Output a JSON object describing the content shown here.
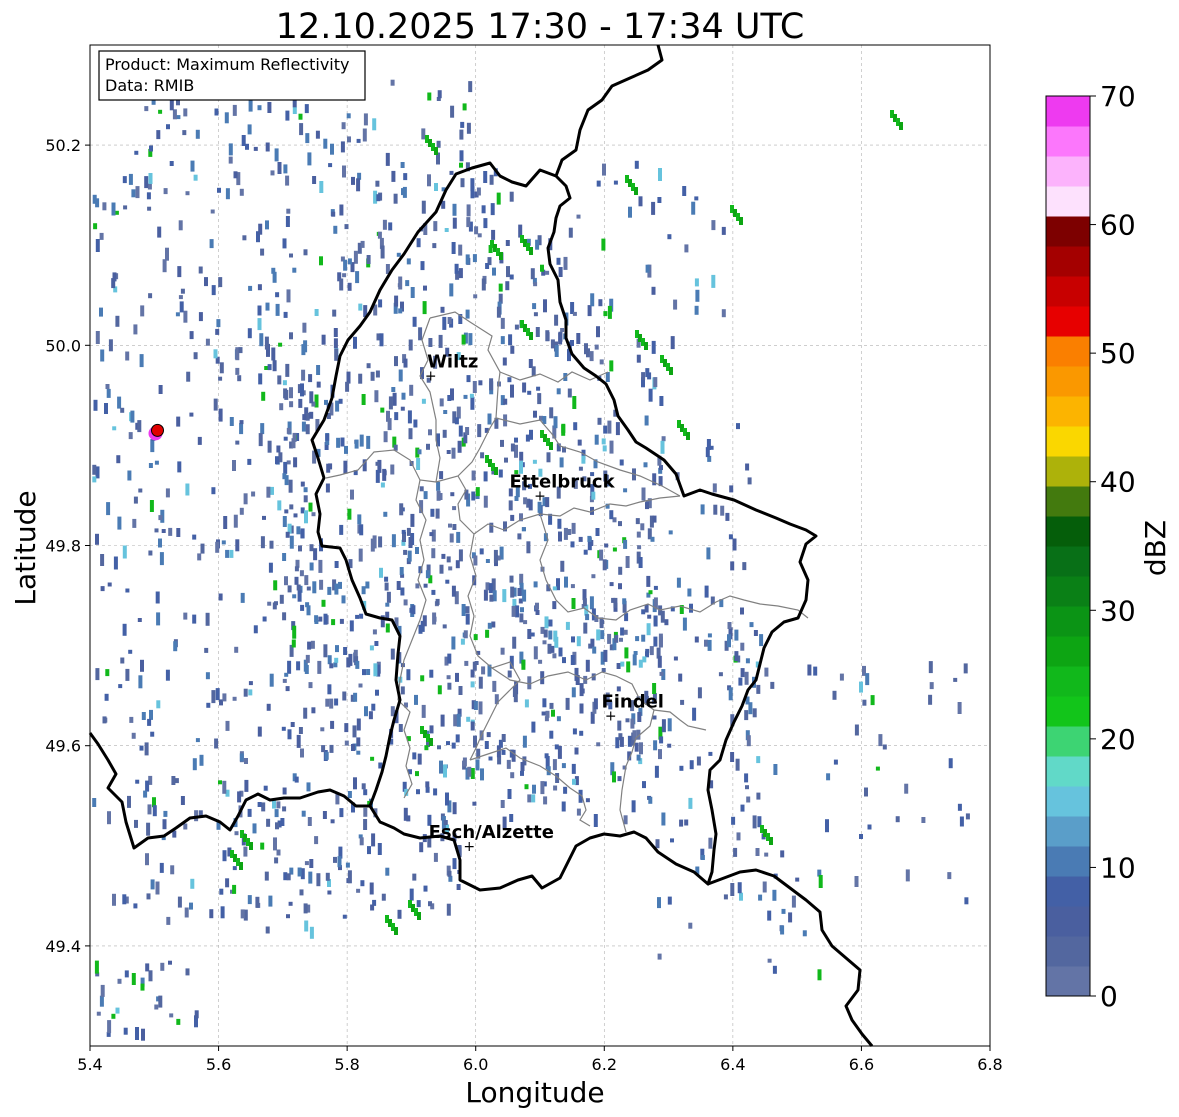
{
  "title": "12.10.2025 17:30 - 17:34 UTC",
  "info_box": {
    "product": "Product: Maximum Reflectivity",
    "data": "Data: RMIB"
  },
  "axes": {
    "xlabel": "Longitude",
    "ylabel": "Latitude",
    "xlim": [
      5.4,
      6.8
    ],
    "ylim": [
      49.3,
      50.3
    ],
    "xticks": [
      "5.4",
      "5.6",
      "5.8",
      "6.0",
      "6.2",
      "6.4",
      "6.6",
      "6.8"
    ],
    "yticks": [
      "49.4",
      "49.6",
      "49.8",
      "50.0",
      "50.2"
    ],
    "grid": true
  },
  "colorbar": {
    "label": "dBZ",
    "ticks": [
      "0",
      "10",
      "20",
      "30",
      "40",
      "50",
      "60",
      "70"
    ],
    "range": [
      0,
      70
    ],
    "colors": [
      "#6374a6",
      "#53679f",
      "#4a5f9f",
      "#4360a6",
      "#4a7bb4",
      "#5a9ec9",
      "#66c3dd",
      "#61d9c8",
      "#3dd473",
      "#12c51a",
      "#11b81b",
      "#0da513",
      "#0b9415",
      "#0a8016",
      "#087017",
      "#055e0a",
      "#437a0e",
      "#adb20a",
      "#fad700",
      "#fcb400",
      "#fa9800",
      "#fa7f00",
      "#e70000",
      "#c80000",
      "#a40000",
      "#7d0000",
      "#fde1fd",
      "#fcb3fc",
      "#fc77fc",
      "#ee3af0"
    ]
  },
  "cities": [
    {
      "name": "Wiltz",
      "lon": 5.93,
      "lat": 49.97
    },
    {
      "name": "Ettelbruck",
      "lon": 6.1,
      "lat": 49.85
    },
    {
      "name": "Findel",
      "lon": 6.21,
      "lat": 49.63
    },
    {
      "name": "Esch/Alzette",
      "lon": 5.99,
      "lat": 49.5
    }
  ],
  "radar_site": {
    "lon": 5.505,
    "lat": 49.915
  },
  "colors": {
    "border": "#000000",
    "district": "#808080",
    "grid": "#b0b0b0",
    "marker_fill": "#e00000",
    "marker_halo": "#ee3af0"
  }
}
